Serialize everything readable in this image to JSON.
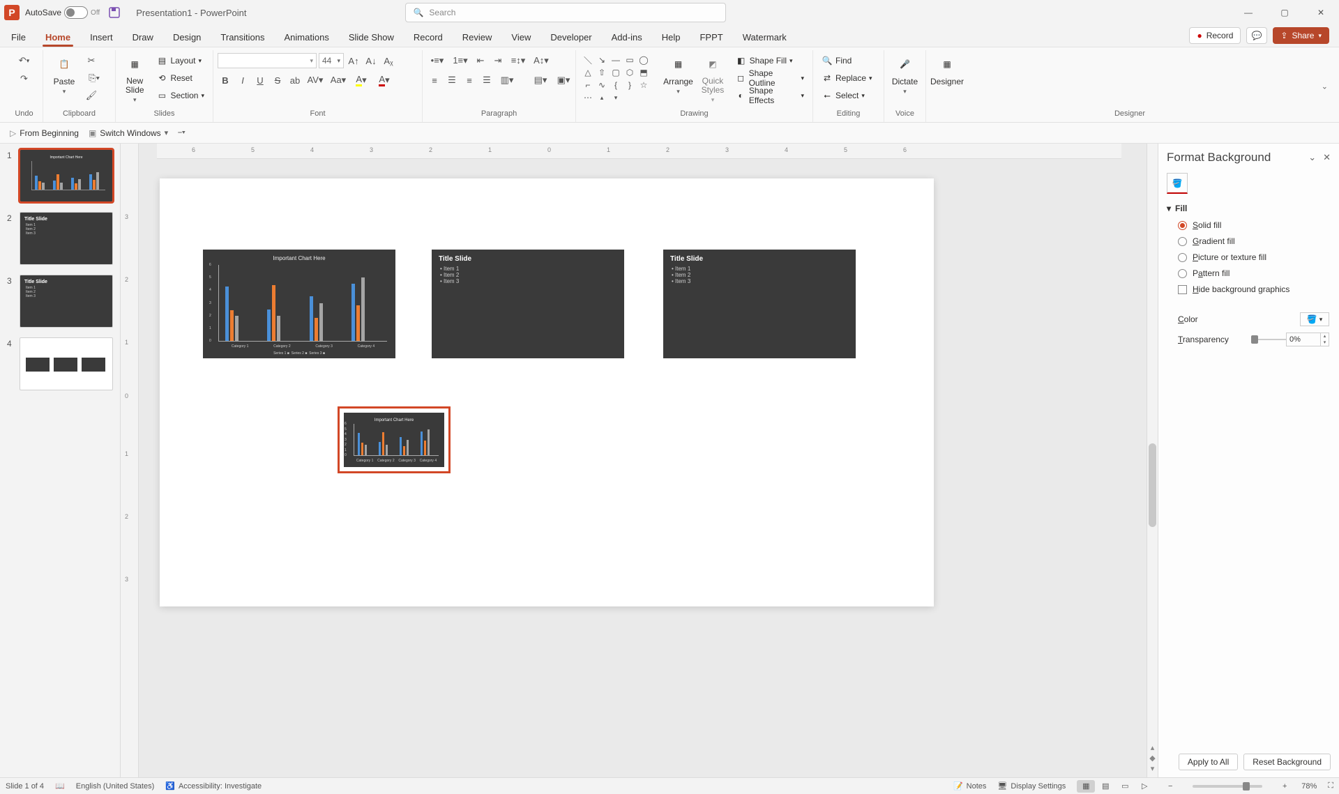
{
  "titlebar": {
    "app_letter": "P",
    "autosave_label": "AutoSave",
    "autosave_state": "Off",
    "document_name": "Presentation1 - PowerPoint",
    "search_placeholder": "Search"
  },
  "window_controls": {
    "min": "—",
    "restore": "▢",
    "close": "✕"
  },
  "ribbon_tabs": {
    "tabs": [
      "File",
      "Home",
      "Insert",
      "Draw",
      "Design",
      "Transitions",
      "Animations",
      "Slide Show",
      "Record",
      "Review",
      "View",
      "Developer",
      "Add-ins",
      "Help",
      "FPPT",
      "Watermark"
    ],
    "active_index": 1,
    "record_btn": "Record",
    "share_btn": "Share"
  },
  "ribbon": {
    "undo": {
      "group": "Undo"
    },
    "clipboard": {
      "paste": "Paste",
      "cut_tt": "Cut",
      "copy_tt": "Copy",
      "fmtpainter_tt": "Format Painter",
      "group": "Clipboard"
    },
    "slides": {
      "new_slide": "New Slide",
      "layout": "Layout",
      "reset": "Reset",
      "section": "Section",
      "group": "Slides"
    },
    "font": {
      "font_size_value": "44",
      "group": "Font"
    },
    "paragraph": {
      "group": "Paragraph"
    },
    "drawing": {
      "arrange": "Arrange",
      "quick_styles": "Quick Styles",
      "shape_fill": "Shape Fill",
      "shape_outline": "Shape Outline",
      "shape_effects": "Shape Effects",
      "group": "Drawing"
    },
    "editing": {
      "find": "Find",
      "replace": "Replace",
      "select": "Select",
      "group": "Editing"
    },
    "voice": {
      "dictate": "Dictate",
      "group": "Voice"
    },
    "designer": {
      "designer": "Designer",
      "group": "Designer"
    }
  },
  "qat": {
    "from_beginning": "From Beginning",
    "switch_windows": "Switch Windows"
  },
  "thumbnails": {
    "slides": [
      {
        "num": "1",
        "kind": "chart",
        "title": "Important Chart Here",
        "selected": true
      },
      {
        "num": "2",
        "kind": "title",
        "title": "Title Slide",
        "items": [
          "Item 1",
          "Item 2",
          "Item 3"
        ],
        "selected": false
      },
      {
        "num": "3",
        "kind": "title",
        "title": "Title Slide",
        "items": [
          "Item 1",
          "Item 2",
          "Item 3"
        ],
        "selected": false
      },
      {
        "num": "4",
        "kind": "summary",
        "selected": false
      }
    ]
  },
  "canvas": {
    "chart_title": "Important Chart Here",
    "title_slide": "Title Slide",
    "items": [
      "Item 1",
      "Item 2",
      "Item 3"
    ],
    "categories": [
      "Category 1",
      "Category 2",
      "Category 3",
      "Category 4"
    ],
    "legend": [
      "Series 1",
      "Series 2",
      "Series 3"
    ]
  },
  "chart_data": {
    "type": "bar",
    "title": "Important Chart Here",
    "categories": [
      "Category 1",
      "Category 2",
      "Category 3",
      "Category 4"
    ],
    "series": [
      {
        "name": "Series 1",
        "values": [
          4.3,
          2.5,
          3.5,
          4.5
        ],
        "color": "#4a90d9"
      },
      {
        "name": "Series 2",
        "values": [
          2.4,
          4.4,
          1.8,
          2.8
        ],
        "color": "#ed7d31"
      },
      {
        "name": "Series 3",
        "values": [
          2.0,
          2.0,
          3.0,
          5.0
        ],
        "color": "#a5a5a5"
      }
    ],
    "ylabel": "",
    "xlabel": "",
    "ylim": [
      0,
      6
    ],
    "yticks": [
      0,
      1,
      2,
      3,
      4,
      5,
      6
    ]
  },
  "h_ruler_ticks": [
    "6",
    "5",
    "4",
    "3",
    "2",
    "1",
    "0",
    "1",
    "2",
    "3",
    "4",
    "5",
    "6"
  ],
  "v_ruler_ticks": [
    "3",
    "2",
    "1",
    "0",
    "1",
    "2",
    "3"
  ],
  "format_pane": {
    "title": "Format Background",
    "section_fill": "Fill",
    "solid_fill": "Solid fill",
    "gradient_fill": "Gradient fill",
    "picture_fill": "Picture or texture fill",
    "pattern_fill": "Pattern fill",
    "hide_bg": "Hide background graphics",
    "color_label": "Color",
    "transparency_label": "Transparency",
    "transparency_value": "0%",
    "apply_all": "Apply to All",
    "reset_bg": "Reset Background"
  },
  "statusbar": {
    "slide_info": "Slide 1 of 4",
    "language": "English (United States)",
    "accessibility": "Accessibility: Investigate",
    "notes": "Notes",
    "display_settings": "Display Settings",
    "zoom_pct": "78%"
  }
}
